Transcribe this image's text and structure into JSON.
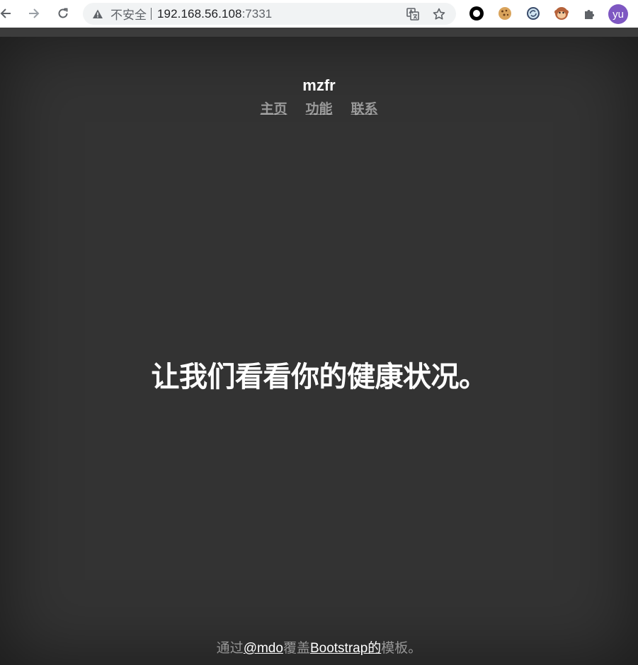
{
  "browser": {
    "security_label": "不安全",
    "url_host": "192.168.56.108",
    "url_port": ":7331",
    "profile_initials": "yu",
    "extensions": [
      "circle-extension-icon",
      "cookie-extension-icon",
      "sync-extension-icon",
      "monkey-extension-icon",
      "puzzle-extensions-icon"
    ]
  },
  "page": {
    "brand": "mzfr",
    "nav": [
      {
        "label": "主页"
      },
      {
        "label": "功能"
      },
      {
        "label": "联系"
      }
    ],
    "headline": "让我们看看你的健康状况。",
    "footer": {
      "prefix": "通过",
      "author_link": "@mdo",
      "middle": "覆盖",
      "bootstrap_link": "Bootstrap",
      "suffix_link": "的",
      "end": "模板。"
    }
  },
  "colors": {
    "page_background": "#333333",
    "avatar": "#7e57c2",
    "muted_text": "rgba(255,255,255,0.5)"
  }
}
